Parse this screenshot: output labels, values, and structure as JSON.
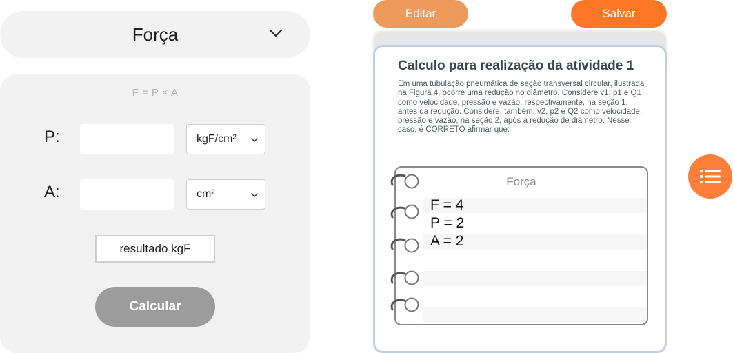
{
  "formula_selector": {
    "selected": "Força",
    "icon": "chevron-down-icon"
  },
  "calculator": {
    "formula": "F = P × A",
    "fields": [
      {
        "label": "P:",
        "value": "",
        "unit": "kgF/cm²"
      },
      {
        "label": "A:",
        "value": "",
        "unit": "cm²"
      }
    ],
    "result": "resultado kgF",
    "calculate_label": "Calcular"
  },
  "toolbar": {
    "edit_label": "Editar",
    "save_label": "Salvar"
  },
  "activity": {
    "title": "Calculo para realização da atividade 1",
    "description": "Em uma tubulação pneumática de seção transversal circular, ilustrada na Figura 4, ocorre uma redução no diâmetro. Considere v1, p1 e Q1 como velocidade, pressão e vazão, respectivamente, na seção 1, antes da redução. Considere, também, v2, p2 e Q2 como velocidade, pressão e vazão, na seção 2, após a redução de diâmetro. Nesse caso, é CORRETO afirmar que:",
    "notebook": {
      "title": "Força",
      "lines": [
        "F = 4",
        "P = 2",
        "A = 2"
      ]
    }
  },
  "fab": {
    "icon": "list-icon"
  },
  "colors": {
    "panel_bg": "#f2f2f2",
    "edit_button": "#ee9a5c",
    "save_button": "#fd7826",
    "calc_button": "#9c9c9c",
    "card_border": "#c3cfe0",
    "fab": "#fd7f3a"
  }
}
